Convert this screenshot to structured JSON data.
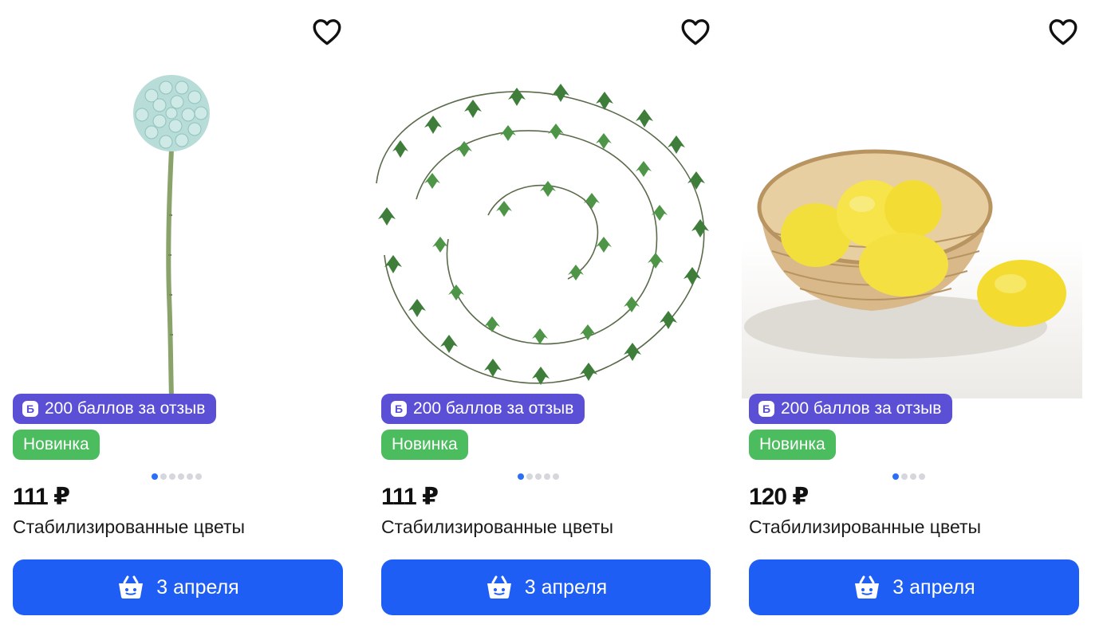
{
  "colors": {
    "points_badge": "#5b4fd6",
    "new_badge": "#4cbd5e",
    "buy_button": "#1f5ef5",
    "dot_active": "#2a6ff5",
    "dot_inactive": "#d5d7dc"
  },
  "products": [
    {
      "icons": {
        "favorite": "heart-outline-icon",
        "points": "points-b-icon",
        "basket": "basket-icon"
      },
      "points_badge": "200 баллов за отзыв",
      "points_letter": "Б",
      "new_badge": "Новинка",
      "price": "111 ₽",
      "title": "Стабилизированные цветы",
      "button_label": "3 апреля",
      "image_count": 6,
      "active_image": 0
    },
    {
      "icons": {
        "favorite": "heart-outline-icon",
        "points": "points-b-icon",
        "basket": "basket-icon"
      },
      "points_badge": "200 баллов за отзыв",
      "points_letter": "Б",
      "new_badge": "Новинка",
      "price": "111 ₽",
      "title": "Стабилизированные цветы",
      "button_label": "3 апреля",
      "image_count": 5,
      "active_image": 0
    },
    {
      "icons": {
        "favorite": "heart-outline-icon",
        "points": "points-b-icon",
        "basket": "basket-icon"
      },
      "points_badge": "200 баллов за отзыв",
      "points_letter": "Б",
      "new_badge": "Новинка",
      "price": "120 ₽",
      "title": "Стабилизированные цветы",
      "button_label": "3 апреля",
      "image_count": 4,
      "active_image": 0
    }
  ]
}
